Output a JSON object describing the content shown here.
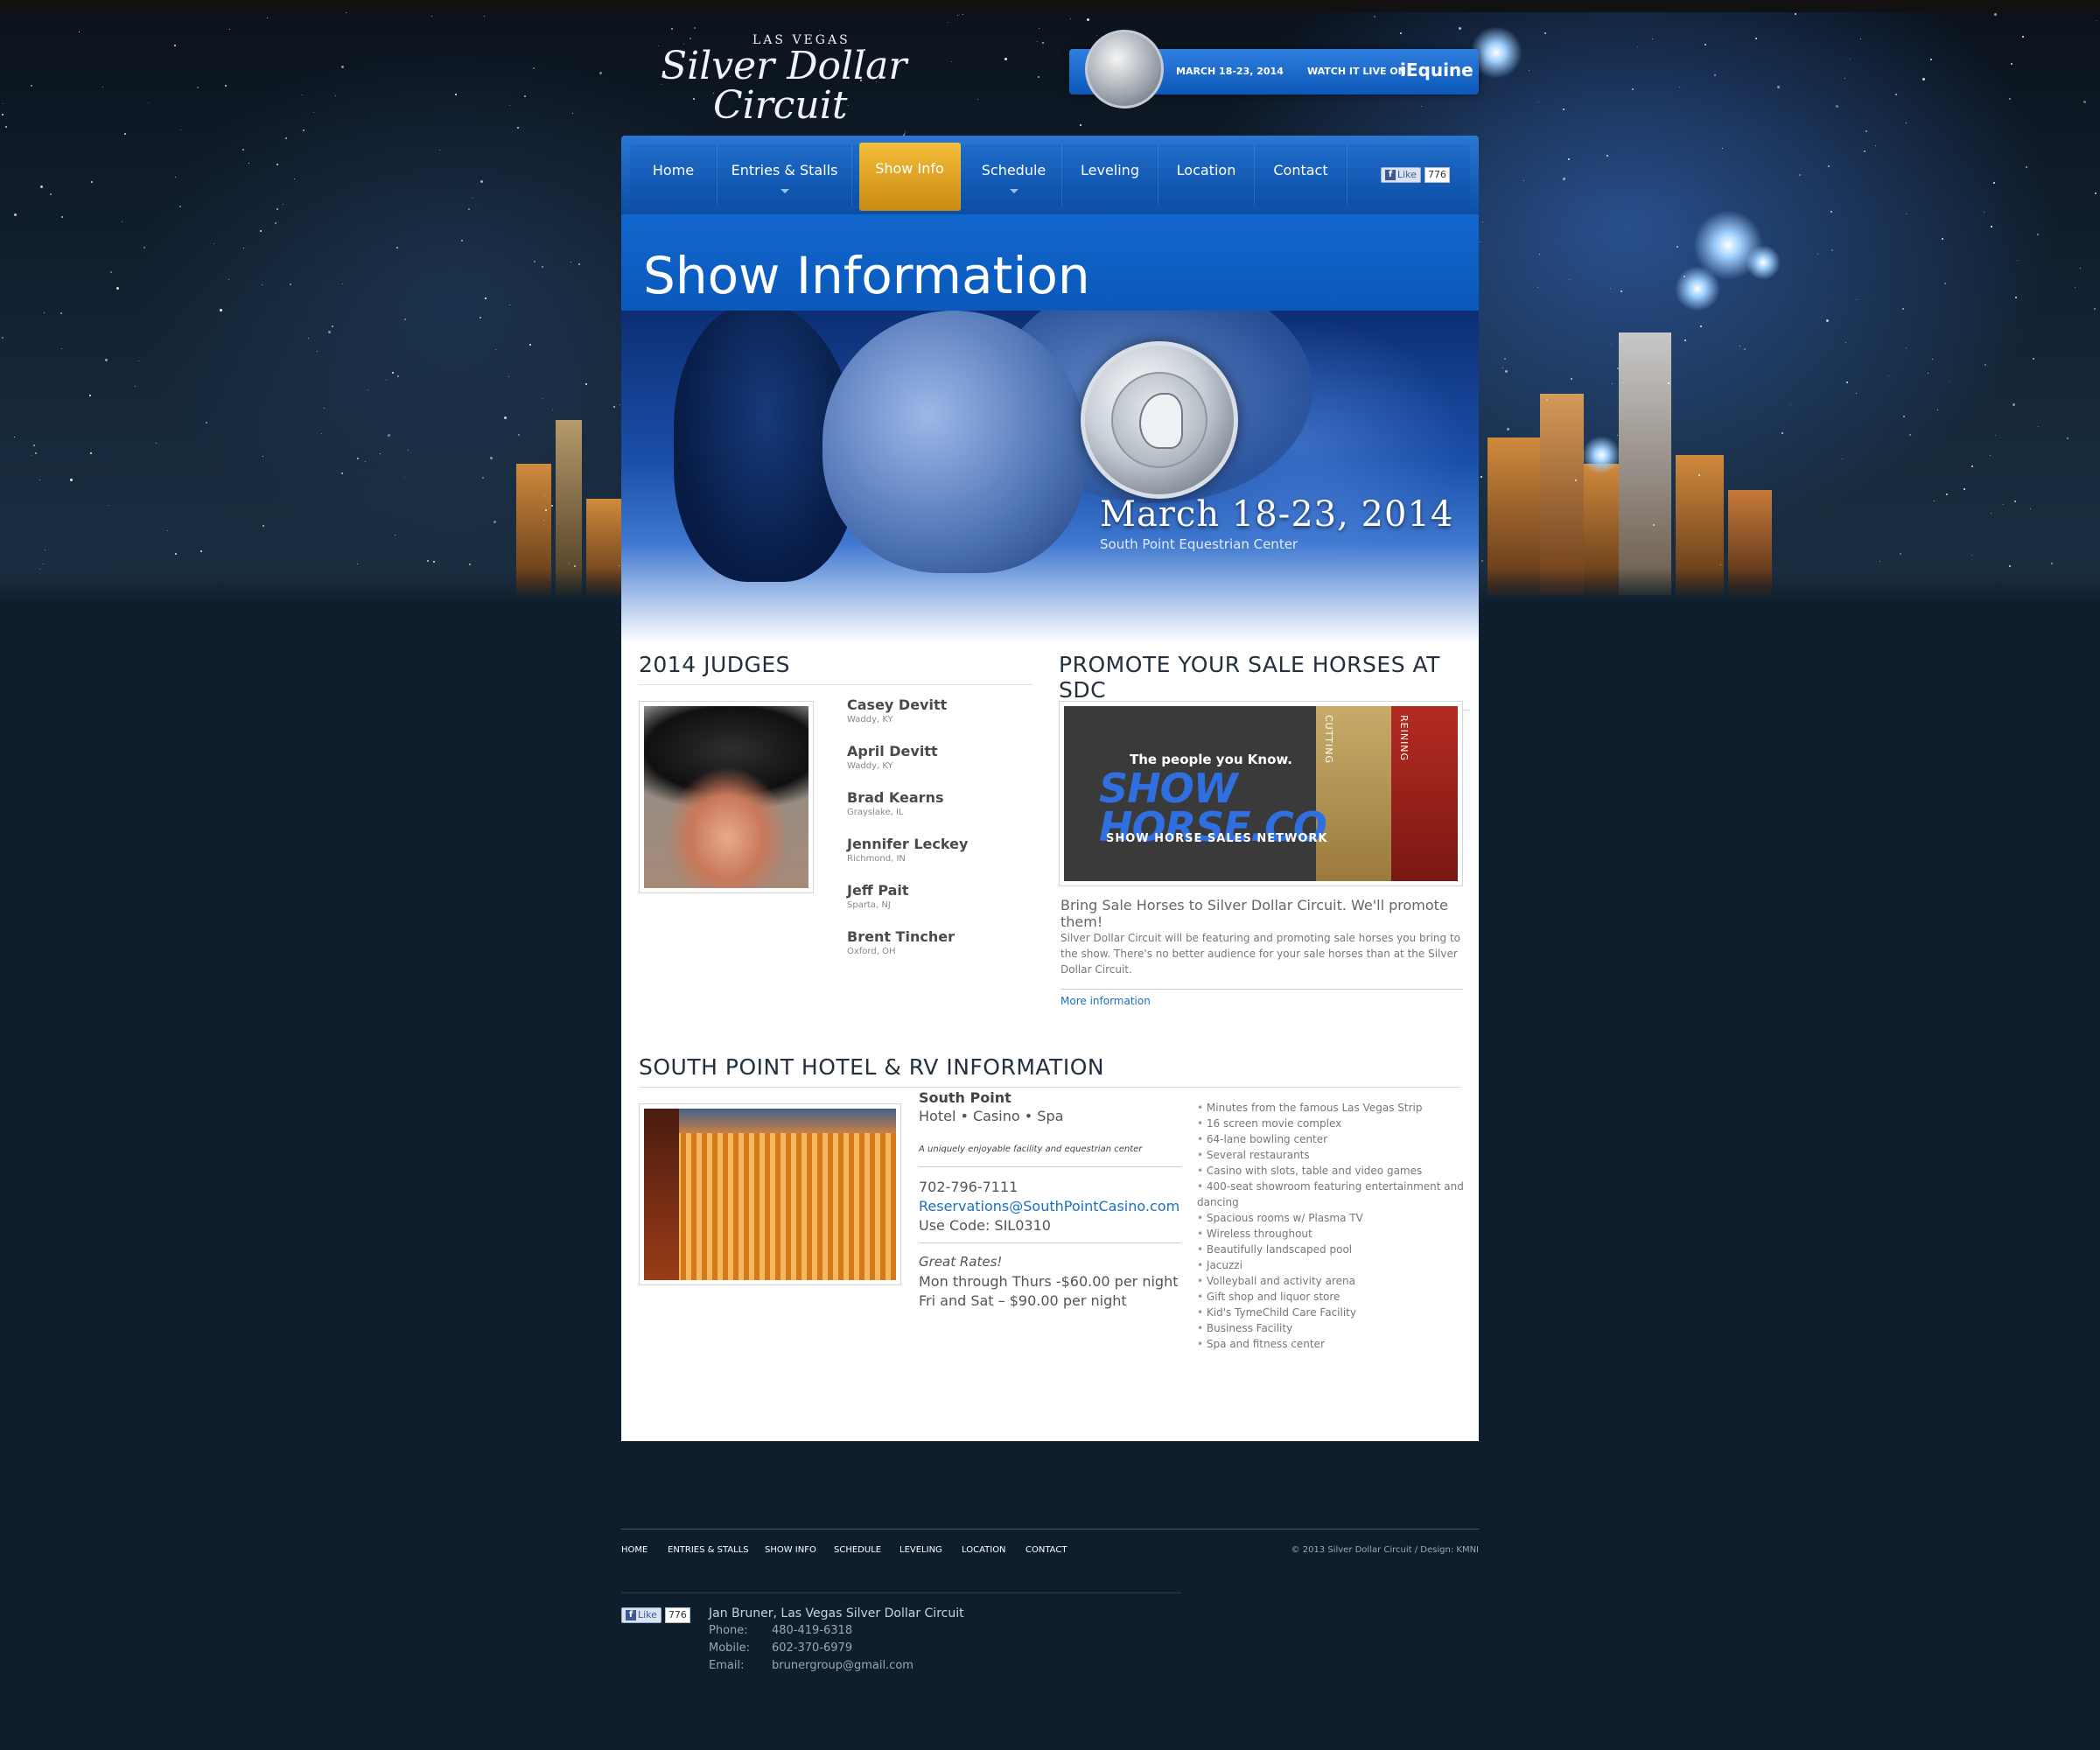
{
  "header": {
    "logo": {
      "line_top": "LAS VEGAS",
      "line1": "Silver Dollar",
      "line2": "Circuit"
    },
    "badge": {
      "date": "MARCH 18-23, 2014",
      "watch": "WATCH IT LIVE ON",
      "brand": "iEquine"
    }
  },
  "nav": {
    "items": [
      {
        "label": "Home",
        "dropdown": false
      },
      {
        "label": "Entries & Stalls",
        "dropdown": true
      },
      {
        "label": "Show Info",
        "dropdown": false,
        "active": true
      },
      {
        "label": "Schedule",
        "dropdown": true
      },
      {
        "label": "Leveling",
        "dropdown": false
      },
      {
        "label": "Location",
        "dropdown": false
      },
      {
        "label": "Contact",
        "dropdown": false
      }
    ],
    "like": {
      "label": "Like",
      "count": "776"
    }
  },
  "page": {
    "title": "Show Information",
    "hero": {
      "date": "March 18-23, 2014",
      "venue": "South Point Equestrian Center"
    }
  },
  "judges": {
    "heading": "2014 JUDGES",
    "list": [
      {
        "name": "Casey Devitt",
        "location": "Waddy, KY"
      },
      {
        "name": "April Devitt",
        "location": "Waddy, KY"
      },
      {
        "name": "Brad Kearns",
        "location": "Grayslake, IL"
      },
      {
        "name": "Jennifer Leckey",
        "location": "Richmond, IN"
      },
      {
        "name": "Jeff Pait",
        "location": "Sparta, NJ"
      },
      {
        "name": "Brent Tincher",
        "location": "Oxford, OH"
      }
    ]
  },
  "promo": {
    "heading": "PROMOTE YOUR SALE HORSES AT SDC",
    "ad": {
      "tagline": "The people you Know.",
      "brand_line1": "SHOW",
      "brand_line2": "HORSE.CO",
      "network": "SHOW HORSE SALES NETWORK",
      "side1": "CUTTING",
      "side2": "REINING"
    },
    "lead": "Bring Sale Horses to Silver Dollar Circuit. We'll promote them!",
    "body": "Silver Dollar Circuit will be featuring and promoting sale horses you bring to the show. There's no better audience for your sale horses than at the Silver Dollar Circuit.",
    "link": "More information"
  },
  "hotel": {
    "heading": "SOUTH POINT HOTEL & RV INFORMATION",
    "name": "South Point",
    "subtitle": "Hotel • Casino • Spa",
    "tagline": "A uniquely enjoyable facility and equestrian center",
    "phone": "702-796-7111",
    "email": "Reservations@SouthPointCasino.com",
    "code": "Use Code: SIL0310",
    "rates_heading": "Great Rates!",
    "rates": [
      "Mon through Thurs -$60.00 per night",
      "Fri and Sat – $90.00 per night"
    ],
    "amenities": [
      "Minutes from the famous Las Vegas Strip",
      "16 screen movie complex",
      "64-lane bowling center",
      "Several restaurants",
      "Casino with slots, table and video games",
      "400-seat showroom featuring entertainment and dancing",
      "Spacious rooms w/ Plasma TV",
      "Wireless throughout",
      "Beautifully landscaped pool",
      "Jacuzzi",
      "Volleyball and activity arena",
      "Gift shop and liquor store",
      "Kid's TymeChild Care Facility",
      "Business Facility",
      "Spa and fitness center"
    ]
  },
  "footer": {
    "nav": [
      "HOME",
      "ENTRIES & STALLS",
      "SHOW INFO",
      "SCHEDULE",
      "LEVELING",
      "LOCATION",
      "CONTACT"
    ],
    "copyright": "© 2013 Silver Dollar Circuit  /  Design: KMNI",
    "contact": {
      "name": "Jan Bruner, Las Vegas Silver Dollar Circuit",
      "rows": [
        {
          "label": "Phone:",
          "value": "480-419-6318"
        },
        {
          "label": "Mobile:",
          "value": "602-370-6979"
        },
        {
          "label": "Email:",
          "value": "brunergroup@gmail.com"
        }
      ]
    }
  }
}
